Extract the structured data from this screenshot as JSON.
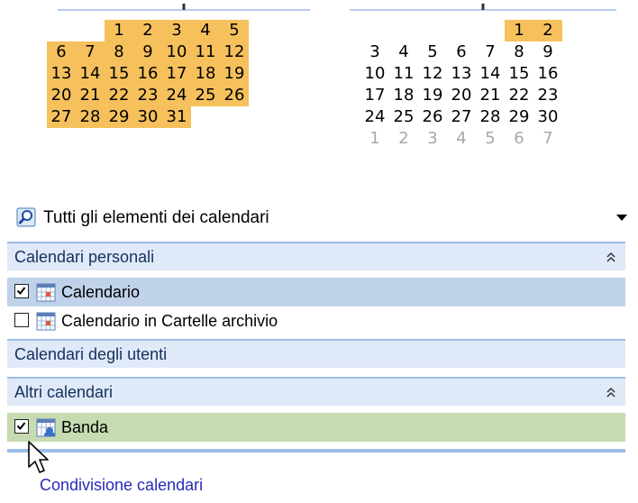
{
  "calendar": {
    "left_month": {
      "weeks": [
        [
          "",
          "",
          "",
          "1",
          "2",
          "3",
          "4",
          "5"
        ],
        [
          "6",
          "7",
          "8",
          "9",
          "10",
          "11",
          "12"
        ],
        [
          "13",
          "14",
          "15",
          "16",
          "17",
          "18",
          "19"
        ],
        [
          "20",
          "21",
          "22",
          "23",
          "24",
          "25",
          "26"
        ],
        [
          "27",
          "28",
          "29",
          "30",
          "31",
          "",
          ""
        ]
      ]
    },
    "right_month": {
      "weeks": [
        [
          "",
          "",
          "",
          "",
          "",
          "1",
          "2"
        ],
        [
          "3",
          "4",
          "5",
          "6",
          "7",
          "8",
          "9"
        ],
        [
          "10",
          "11",
          "12",
          "13",
          "14",
          "15",
          "16"
        ],
        [
          "17",
          "18",
          "19",
          "20",
          "21",
          "22",
          "23"
        ],
        [
          "24",
          "25",
          "26",
          "27",
          "28",
          "29",
          "30"
        ],
        [
          "1",
          "2",
          "3",
          "4",
          "5",
          "6",
          "7"
        ]
      ]
    },
    "highlight_color": "#f6c15c"
  },
  "search": {
    "label": "Tutti gli elementi dei calendari",
    "icon": "magnifier-icon"
  },
  "sections": {
    "personal": {
      "label": "Calendari personali",
      "items": [
        {
          "label": "Calendario",
          "checked": true,
          "selected": true
        },
        {
          "label": "Calendario in Cartelle archivio",
          "checked": false
        }
      ]
    },
    "users": {
      "label": "Calendari degli utenti"
    },
    "others": {
      "label": "Altri calendari",
      "items": [
        {
          "label": "Banda",
          "checked": true
        }
      ]
    }
  },
  "footer": {
    "share_link": "Condivisione calendari"
  },
  "colors": {
    "section_bg": "#dfe9f7",
    "selected_bg": "#c0d2ea",
    "green_bg": "#c7dbb2",
    "link": "#2929b8"
  }
}
